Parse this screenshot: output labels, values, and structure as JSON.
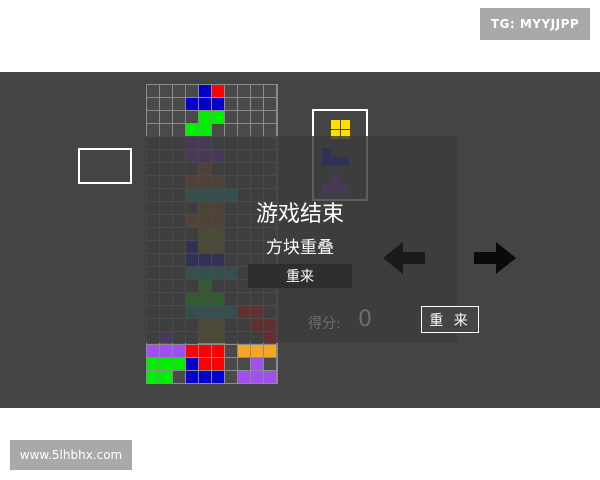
{
  "watermark_tg": "TG: MYYJJPP",
  "watermark_site": "www.5lhbhx.com",
  "game_over": {
    "title": "游戏结束",
    "reason": "方块重叠",
    "restart_label": "重来"
  },
  "score": {
    "label": "得分:",
    "value": "0"
  },
  "restart_button_label": "重 来",
  "colors": {
    "background": "#444444",
    "red": "#ff0000",
    "blue": "#0000cc",
    "green": "#00ee00",
    "purple": "#7b2fd0",
    "violet": "#a050f0",
    "orange": "#f5a623",
    "yellow": "#ffe000",
    "teal": "#1a9ea0",
    "brown": "#a0641e",
    "olive": "#8c8c1e"
  },
  "icons": [
    "left-arrow-icon",
    "right-arrow-icon"
  ]
}
